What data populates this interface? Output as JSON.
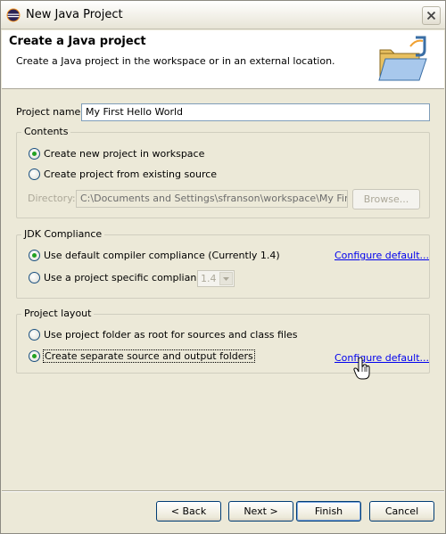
{
  "window": {
    "title": "New Java Project"
  },
  "header": {
    "title": "Create a Java project",
    "description": "Create a Java project in the workspace or in an external location."
  },
  "project_name": {
    "label": "Project name:",
    "value": "My First Hello World"
  },
  "contents": {
    "legend": "Contents",
    "option_new": "Create new project in workspace",
    "option_existing": "Create project from existing source",
    "selected": "option_new",
    "directory_label": "Directory:",
    "directory_value": "C:\\Documents and Settings\\sfranson\\workspace\\My First Hello",
    "browse_label": "Browse..."
  },
  "jdk": {
    "legend": "JDK Compliance",
    "option_default": "Use default compiler compliance (Currently 1.4)",
    "option_specific": "Use a project specific compliance:",
    "selected": "option_default",
    "compliance_value": "1.4",
    "configure_link": "Configure default..."
  },
  "layout": {
    "legend": "Project layout",
    "option_root": "Use project folder as root for sources and class files",
    "option_separate": "Create separate source and output folders",
    "selected": "option_separate",
    "configure_link": "Configure default..."
  },
  "buttons": {
    "back": "< Back",
    "next": "Next >",
    "finish": "Finish",
    "cancel": "Cancel"
  }
}
